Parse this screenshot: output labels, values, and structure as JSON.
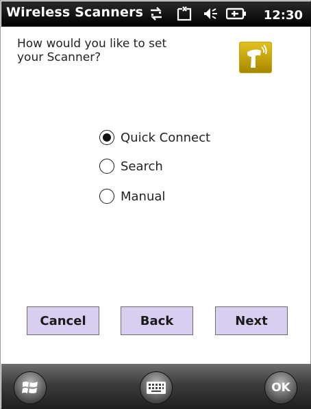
{
  "titlebar": {
    "app_title": "Wireless Scanners",
    "time": "12:30",
    "icons": [
      "connectivity-icon",
      "signal-off-icon",
      "speaker-icon",
      "battery-icon"
    ]
  },
  "prompt": {
    "line1": "How would you like to set",
    "line2": "your Scanner?"
  },
  "options": [
    {
      "label": "Quick Connect",
      "selected": true
    },
    {
      "label": "Search",
      "selected": false
    },
    {
      "label": "Manual",
      "selected": false
    }
  ],
  "buttons": {
    "cancel": "Cancel",
    "back": "Back",
    "next": "Next"
  },
  "bottombar": {
    "start_icon": "windows-start-icon",
    "keyboard_icon": "keyboard-icon",
    "ok_label": "OK"
  },
  "colors": {
    "button_bg": "#d8cef0",
    "titlebar_bg": "#000000",
    "app_icon": "#c9a400"
  }
}
